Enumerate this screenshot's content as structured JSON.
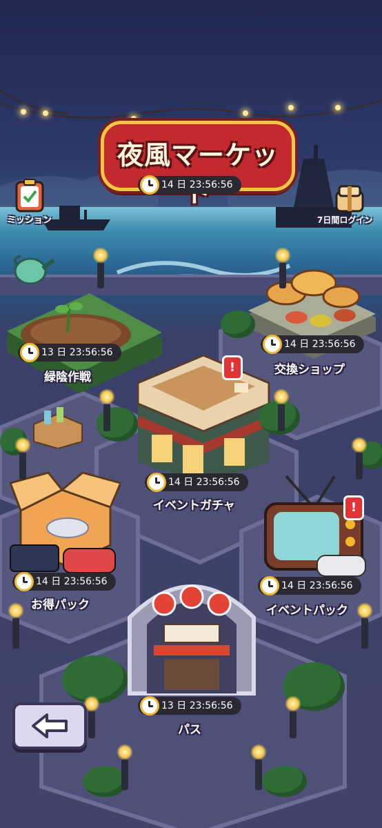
{
  "title": "夜風マーケット",
  "title_timer": "14 日 23:56:56",
  "corner": {
    "mission_label": "ミッション",
    "login_label": "7日間ログイン"
  },
  "stalls": [
    {
      "key": "greenery",
      "label": "緑陰作戦",
      "timer": "13 日 23:56:56"
    },
    {
      "key": "exchange",
      "label": "交換ショップ",
      "timer": "14 日 23:56:56"
    },
    {
      "key": "gacha",
      "label": "イベントガチャ",
      "timer": "14 日 23:56:56"
    },
    {
      "key": "deal",
      "label": "お得パック",
      "timer": "14 日 23:56:56"
    },
    {
      "key": "eventpack",
      "label": "イベントパック",
      "timer": "14 日 23:56:56"
    },
    {
      "key": "pass",
      "label": "パス",
      "timer": "13 日 23:56:56"
    }
  ],
  "badges": {
    "gacha": "!",
    "eventpack": "!"
  },
  "icons": {
    "back": "back-arrow-icon",
    "clock": "clock-icon",
    "mission": "clipboard-check-icon",
    "login": "gift-box-icon"
  },
  "colors": {
    "title_bg": "#c22a30",
    "title_border": "#f5c544",
    "timer_bg": "#2a2833",
    "badge": "#e23434",
    "back_button": "#dcd8ef"
  }
}
